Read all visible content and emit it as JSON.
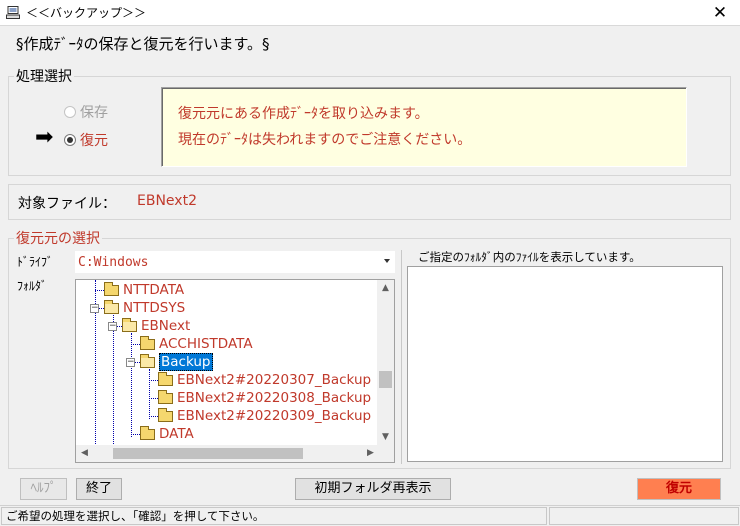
{
  "window": {
    "title": "＜＜バックアップ＞＞",
    "close_label": "✕"
  },
  "header": {
    "text": "§作成ﾃﾞｰﾀの保存と復元を行います。§"
  },
  "process_selection": {
    "label": "処理選択",
    "options": [
      {
        "label": "保存",
        "selected": false,
        "enabled": false
      },
      {
        "label": "復元",
        "selected": true,
        "enabled": true
      }
    ],
    "arrow": "➡",
    "message_lines": [
      "復元元にある作成ﾃﾞｰﾀを取り込みます。",
      "現在のﾃﾞｰﾀは失われますのでご注意ください。"
    ]
  },
  "target": {
    "label": "対象ファイル：",
    "value": "EBNext2"
  },
  "source": {
    "label": "復元元の選択",
    "drive_label": "ﾄﾞﾗｲﾌﾞ",
    "drive_value": "C:Windows",
    "folder_label": "ﾌｫﾙﾀﾞ",
    "tree": [
      "NTTDATA",
      "NTTDSYS",
      "EBNext",
      "ACCHISTDATA",
      "Backup",
      "EBNext2#20220307_Backup",
      "EBNext2#20220308_Backup",
      "EBNext2#20220309_Backup",
      "DATA"
    ],
    "file_list_note": "ご指定のﾌｫﾙﾀﾞ内のﾌｧｲﾙを表示しています。"
  },
  "buttons": {
    "help": "ﾍﾙﾌﾟ",
    "exit": "終了",
    "reset_folder": "初期フォルダ再表示",
    "restore": "復元"
  },
  "status": {
    "message": "ご希望の処理を選択し、「確認」を押して下さい。"
  },
  "colors": {
    "accent_red": "#c0392b",
    "info_bg": "#ffffe1",
    "selection": "#0078d7",
    "restore_button": "#ff7f50"
  }
}
